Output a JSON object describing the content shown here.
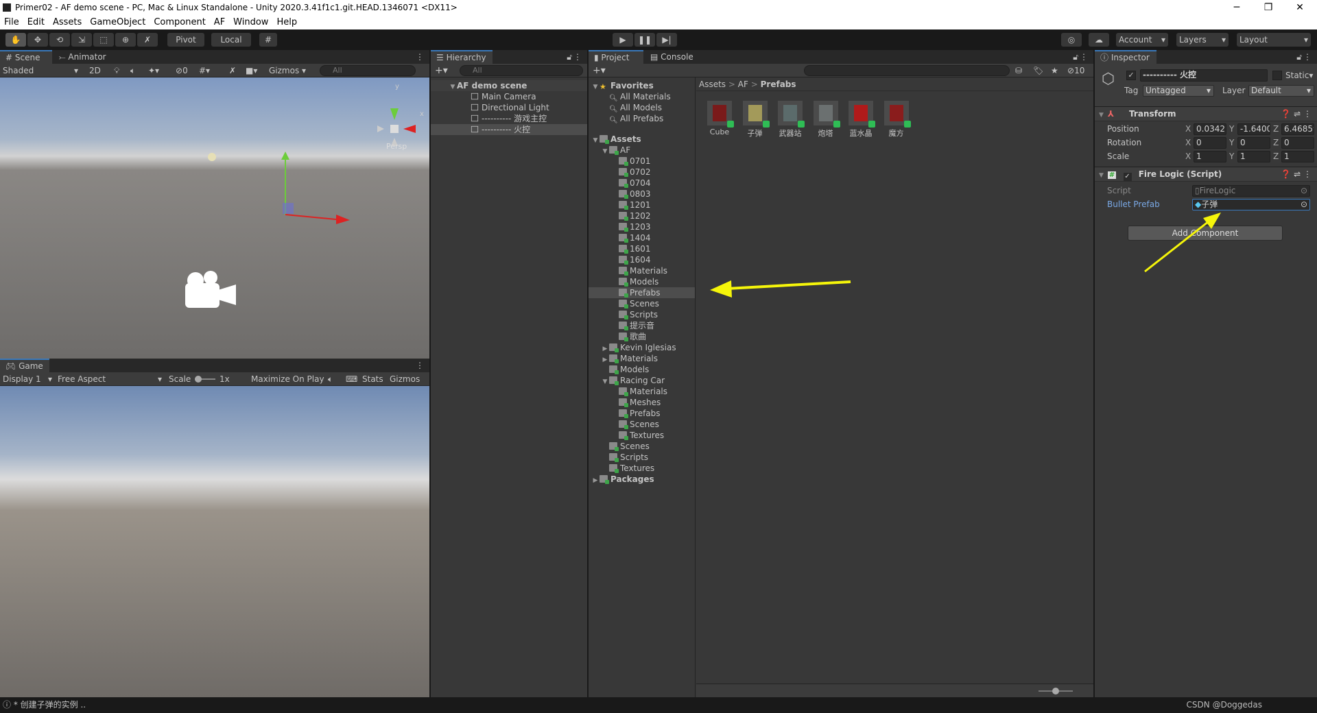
{
  "window": {
    "title": "Primer02 - AF demo scene - PC, Mac & Linux Standalone - Unity 2020.3.41f1c1.git.HEAD.1346071 <DX11>",
    "minimize": "─",
    "maximize": "❐",
    "close": "✕"
  },
  "menu": [
    "File",
    "Edit",
    "Assets",
    "GameObject",
    "Component",
    "AF",
    "Window",
    "Help"
  ],
  "toolbar": {
    "pivot": "Pivot",
    "local": "Local",
    "account": "Account",
    "layers": "Layers",
    "layout": "Layout"
  },
  "scene": {
    "tab_scene": "Scene",
    "tab_animator": "Animator",
    "shading": "Shaded",
    "mode2d": "2D",
    "hidden_count": "0",
    "gizmos": "Gizmos",
    "search_placeholder": "All",
    "persp": "Persp",
    "axis_y": "y",
    "axis_x": "x"
  },
  "game": {
    "tab": "Game",
    "display": "Display 1",
    "aspect": "Free Aspect",
    "scale_label": "Scale",
    "scale_value": "1x",
    "scale_fraction": 0.0,
    "maximize": "Maximize On Play",
    "stats": "Stats",
    "gizmos": "Gizmos"
  },
  "hierarchy": {
    "tab": "Hierarchy",
    "search_placeholder": "All",
    "scene": "AF demo scene",
    "items": [
      "Main Camera",
      "Directional Light",
      "---------- 游戏主控",
      "---------- 火控"
    ],
    "selected": 3
  },
  "project": {
    "tab_project": "Project",
    "tab_console": "Console",
    "hidden_count": "10",
    "breadcrumb": [
      "Assets",
      "AF",
      "Prefabs"
    ],
    "breadcrumb_sep": ">",
    "tree": [
      {
        "label": "Favorites",
        "depth": 0,
        "type": "fav",
        "open": true,
        "bold": true
      },
      {
        "label": "All Materials",
        "depth": 1,
        "type": "search"
      },
      {
        "label": "All Models",
        "depth": 1,
        "type": "search"
      },
      {
        "label": "All Prefabs",
        "depth": 1,
        "type": "search"
      },
      {
        "label": "Assets",
        "depth": 0,
        "type": "folder",
        "open": true,
        "bold": true,
        "gap": true
      },
      {
        "label": "AF",
        "depth": 1,
        "type": "folder",
        "open": true
      },
      {
        "label": "0701",
        "depth": 2,
        "type": "folder"
      },
      {
        "label": "0702",
        "depth": 2,
        "type": "folder"
      },
      {
        "label": "0704",
        "depth": 2,
        "type": "folder"
      },
      {
        "label": "0803",
        "depth": 2,
        "type": "folder"
      },
      {
        "label": "1201",
        "depth": 2,
        "type": "folder"
      },
      {
        "label": "1202",
        "depth": 2,
        "type": "folder"
      },
      {
        "label": "1203",
        "depth": 2,
        "type": "folder"
      },
      {
        "label": "1404",
        "depth": 2,
        "type": "folder"
      },
      {
        "label": "1601",
        "depth": 2,
        "type": "folder"
      },
      {
        "label": "1604",
        "depth": 2,
        "type": "folder"
      },
      {
        "label": "Materials",
        "depth": 2,
        "type": "folder"
      },
      {
        "label": "Models",
        "depth": 2,
        "type": "folder"
      },
      {
        "label": "Prefabs",
        "depth": 2,
        "type": "folder",
        "selected": true
      },
      {
        "label": "Scenes",
        "depth": 2,
        "type": "folder"
      },
      {
        "label": "Scripts",
        "depth": 2,
        "type": "folder"
      },
      {
        "label": "提示音",
        "depth": 2,
        "type": "folder"
      },
      {
        "label": "歌曲",
        "depth": 2,
        "type": "folder"
      },
      {
        "label": "Kevin Iglesias",
        "depth": 1,
        "type": "folder",
        "closed": true
      },
      {
        "label": "Materials",
        "depth": 1,
        "type": "folder",
        "closed": true
      },
      {
        "label": "Models",
        "depth": 1,
        "type": "folder"
      },
      {
        "label": "Racing Car",
        "depth": 1,
        "type": "folder",
        "open": true
      },
      {
        "label": "Materials",
        "depth": 2,
        "type": "folder"
      },
      {
        "label": "Meshes",
        "depth": 2,
        "type": "folder"
      },
      {
        "label": "Prefabs",
        "depth": 2,
        "type": "folder"
      },
      {
        "label": "Scenes",
        "depth": 2,
        "type": "folder"
      },
      {
        "label": "Textures",
        "depth": 2,
        "type": "folder"
      },
      {
        "label": "Scenes",
        "depth": 1,
        "type": "folder"
      },
      {
        "label": "Scripts",
        "depth": 1,
        "type": "folder"
      },
      {
        "label": "Textures",
        "depth": 1,
        "type": "folder"
      },
      {
        "label": "Packages",
        "depth": 0,
        "type": "folder",
        "closed": true,
        "bold": true
      }
    ],
    "assets": [
      {
        "label": "Cube",
        "color": "#7a1a1a"
      },
      {
        "label": "子弹",
        "color": "#a39a5a"
      },
      {
        "label": "武器站",
        "color": "#5b6b6b"
      },
      {
        "label": "炮塔",
        "color": "#6b7070"
      },
      {
        "label": "蓝水晶",
        "color": "#b01a1a"
      },
      {
        "label": "魔方",
        "color": "#8a1c1c"
      }
    ]
  },
  "inspector": {
    "tab": "Inspector",
    "object_name": "---------- 火控",
    "active": true,
    "static_label": "Static",
    "tag_label": "Tag",
    "tag": "Untagged",
    "layer_label": "Layer",
    "layer": "Default",
    "transform": {
      "title": "Transform",
      "rows": [
        {
          "label": "Position",
          "x": "0.0342",
          "y": "-1.6400",
          "z": "6.46859"
        },
        {
          "label": "Rotation",
          "x": "0",
          "y": "0",
          "z": "0"
        },
        {
          "label": "Scale",
          "x": "1",
          "y": "1",
          "z": "1"
        }
      ]
    },
    "script": {
      "title": "Fire Logic (Script)",
      "script_label": "Script",
      "script_value": "FireLogic",
      "bullet_label": "Bullet Prefab",
      "bullet_value": "子弹"
    },
    "add_component": "Add Component"
  },
  "status": {
    "message": "* 创建子弹的实例 ..",
    "watermark": "CSDN @Doggedas"
  },
  "colors": {
    "accent": "#3a79bb",
    "annotation_arrow": "#f5f50a",
    "selection": "#4d4d4d"
  }
}
